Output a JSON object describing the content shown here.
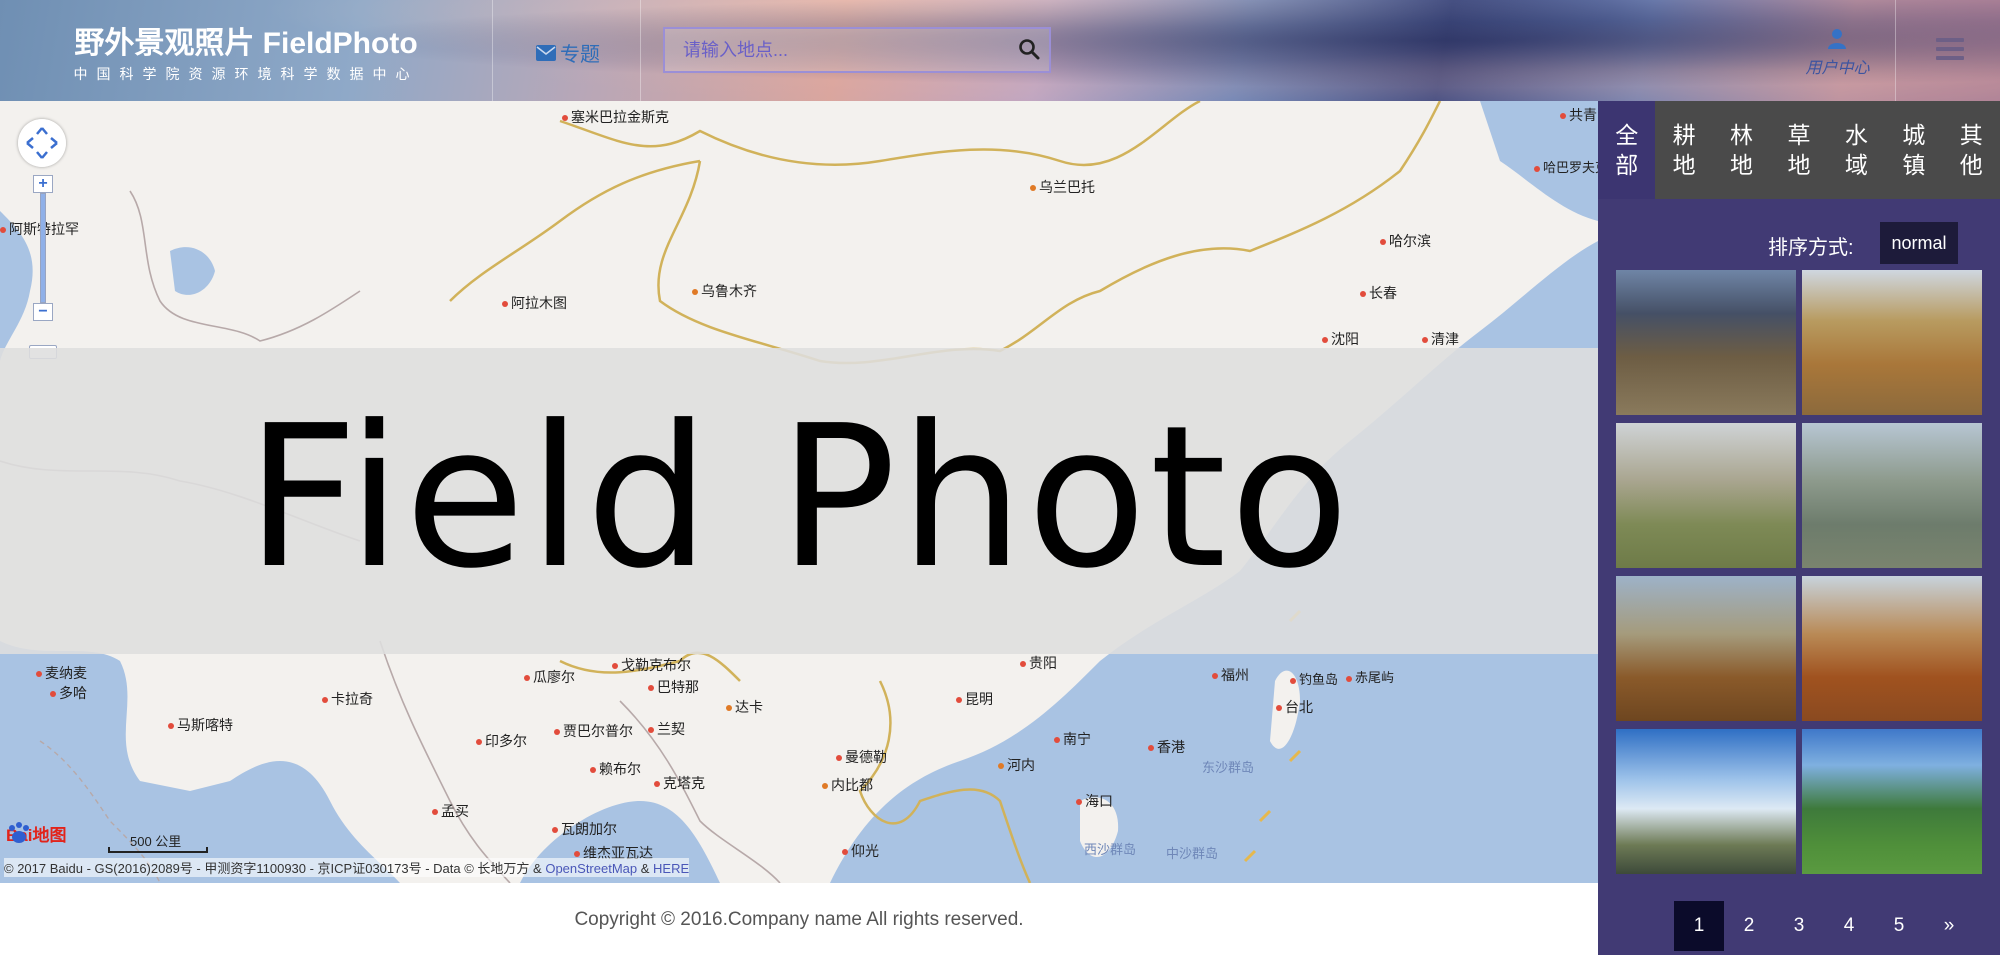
{
  "header": {
    "brand_title": "野外景观照片 FieldPhoto",
    "brand_subtitle": "中国科学院资源环境科学数据中心",
    "topic_label": "专题",
    "search_placeholder": "请输入地点...",
    "user_center_label": "用户中心"
  },
  "map": {
    "cities": [
      {
        "name": "塞米巴拉金斯克",
        "kind": "city"
      },
      {
        "name": "乌兰巴托",
        "kind": "cap"
      },
      {
        "name": "阿斯特拉罕",
        "kind": "city"
      },
      {
        "name": "乌鲁木齐",
        "kind": "cap"
      },
      {
        "name": "阿拉木图",
        "kind": "city"
      },
      {
        "name": "哈尔滨",
        "kind": "city"
      },
      {
        "name": "长春",
        "kind": "city"
      },
      {
        "name": "沈阳",
        "kind": "city"
      },
      {
        "name": "清津",
        "kind": "city"
      },
      {
        "name": "哈巴罗夫克（伯力）",
        "kind": "city"
      },
      {
        "name": "共青",
        "kind": "city"
      },
      {
        "name": "麦纳麦",
        "kind": "city"
      },
      {
        "name": "多哈",
        "kind": "city"
      },
      {
        "name": "卡拉奇",
        "kind": "city"
      },
      {
        "name": "马斯喀特",
        "kind": "city"
      },
      {
        "name": "瓜廖尔",
        "kind": "city"
      },
      {
        "name": "戈勒克布尔",
        "kind": "city"
      },
      {
        "name": "巴特那",
        "kind": "city"
      },
      {
        "name": "达卡",
        "kind": "cap"
      },
      {
        "name": "印多尔",
        "kind": "city"
      },
      {
        "name": "贾巴尔普尔",
        "kind": "city"
      },
      {
        "name": "兰契",
        "kind": "city"
      },
      {
        "name": "贵阳",
        "kind": "city"
      },
      {
        "name": "昆明",
        "kind": "city"
      },
      {
        "name": "福州",
        "kind": "city"
      },
      {
        "name": "钓鱼岛",
        "kind": "city"
      },
      {
        "name": "赤尾屿",
        "kind": "city"
      },
      {
        "name": "台北",
        "kind": "city"
      },
      {
        "name": "赖布尔",
        "kind": "city"
      },
      {
        "name": "克塔克",
        "kind": "city"
      },
      {
        "name": "曼德勒",
        "kind": "city"
      },
      {
        "name": "南宁",
        "kind": "city"
      },
      {
        "name": "香港",
        "kind": "city"
      },
      {
        "name": "河内",
        "kind": "cap"
      },
      {
        "name": "内比都",
        "kind": "cap"
      },
      {
        "name": "海口",
        "kind": "city"
      },
      {
        "name": "东沙群岛",
        "kind": "city"
      },
      {
        "name": "孟买",
        "kind": "city"
      },
      {
        "name": "瓦朗加尔",
        "kind": "city"
      },
      {
        "name": "维杰亚瓦达",
        "kind": "city"
      },
      {
        "name": "仰光",
        "kind": "city"
      },
      {
        "name": "西沙群岛",
        "kind": "city"
      },
      {
        "name": "中沙群岛",
        "kind": "city"
      }
    ],
    "scale_label": "500 公里",
    "baidu_logo_text": "Bai",
    "baidu_logo_suffix": "地图",
    "attribution_main": "© 2017 Baidu - GS(2016)2089号 - 甲测资字1100930 - 京ICP证030173号 - Data © 长地万方 &",
    "attribution_osm": "OpenStreetMap",
    "attribution_amp": "&",
    "attribution_here": "HERE"
  },
  "overlay": {
    "text": "Field Photo"
  },
  "footer": {
    "copyright": "Copyright © 2016.Company name All rights reserved."
  },
  "sidebar": {
    "categories": [
      {
        "label": "全部",
        "active": true
      },
      {
        "label": "耕地",
        "active": false
      },
      {
        "label": "林地",
        "active": false
      },
      {
        "label": "草地",
        "active": false
      },
      {
        "label": "水域",
        "active": false
      },
      {
        "label": "城镇",
        "active": false
      },
      {
        "label": "其他",
        "active": false
      }
    ],
    "sort_label": "排序方式:",
    "sort_value": "normal",
    "pagination": [
      "1",
      "2",
      "3",
      "4",
      "5",
      "»"
    ],
    "active_page": "1"
  },
  "colors": {
    "sidebar_bg": "#413a74",
    "category_bar": "#4a4a4a",
    "active_page": "#0b0b2a",
    "map_land": "#f3f1ee",
    "map_water": "#a9c3e3",
    "border": "#d1b25a"
  }
}
